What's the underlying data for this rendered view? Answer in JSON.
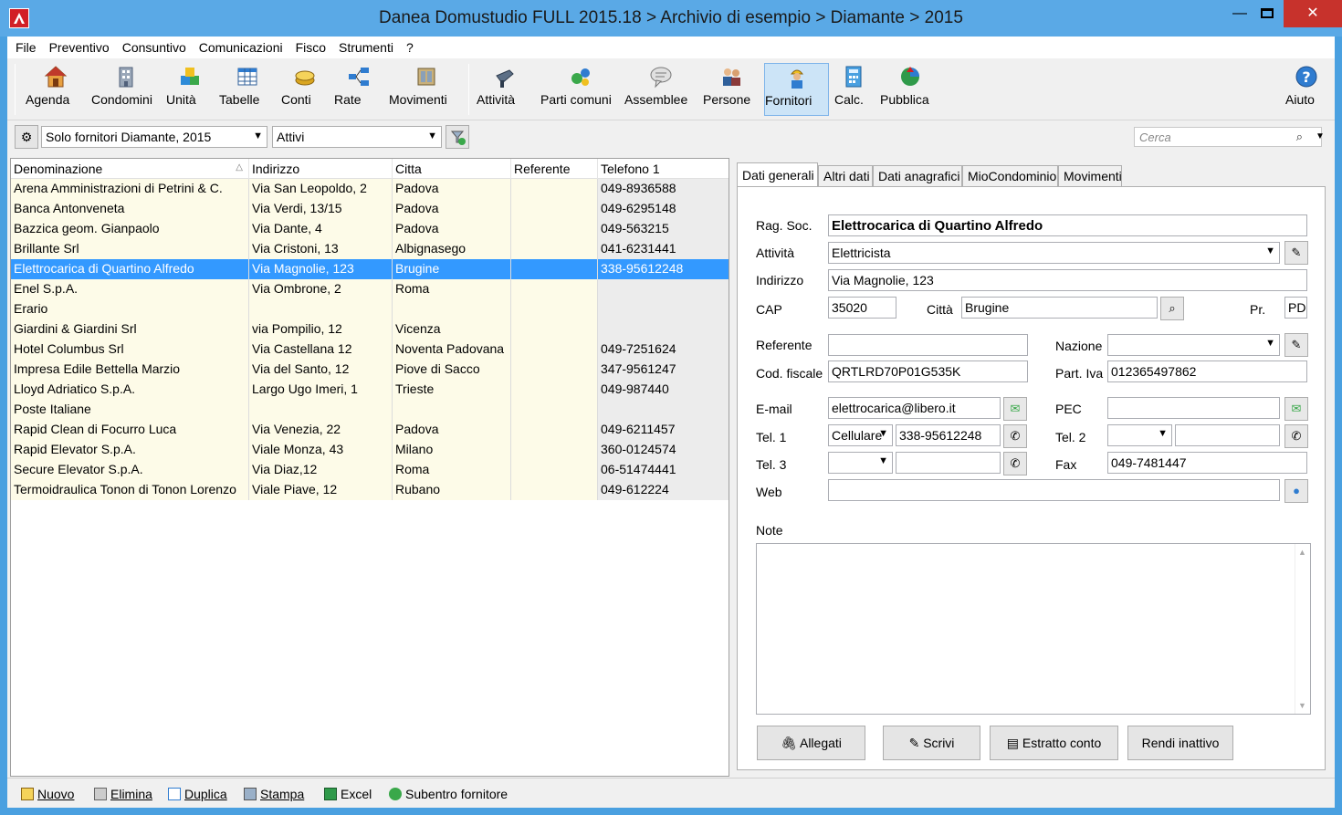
{
  "window": {
    "title": "Danea Domustudio FULL 2015.18 > Archivio di esempio > Diamante > 2015",
    "minimize": "—",
    "close": "✕"
  },
  "menu": [
    "File",
    "Preventivo",
    "Consuntivo",
    "Comunicazioni",
    "Fisco",
    "Strumenti",
    "?"
  ],
  "toolbar": {
    "buttons": [
      {
        "label": "Agenda",
        "icon": "house-icon"
      },
      {
        "label": "Condomini",
        "icon": "building-icon"
      },
      {
        "label": "Unità",
        "icon": "cubes-icon"
      },
      {
        "label": "Tabelle",
        "icon": "table-icon"
      },
      {
        "label": "Conti",
        "icon": "coins-icon"
      },
      {
        "label": "Rate",
        "icon": "flow-icon"
      },
      {
        "label": "Movimenti",
        "icon": "cash-icon"
      },
      {
        "label": "Attività",
        "icon": "drill-icon"
      },
      {
        "label": "Parti comuni",
        "icon": "gears-icon"
      },
      {
        "label": "Assemblee",
        "icon": "chat-icon"
      },
      {
        "label": "Persone",
        "icon": "people-icon"
      },
      {
        "label": "Fornitori",
        "icon": "worker-icon"
      },
      {
        "label": "Calc.",
        "icon": "calculator-icon"
      },
      {
        "label": "Pubblica",
        "icon": "globe-icon"
      }
    ],
    "help_label": "Aiuto",
    "active": "Fornitori"
  },
  "filters": {
    "supplier_filter": "Solo fornitori Diamante, 2015",
    "status_filter": "Attivi",
    "search_placeholder": "Cerca"
  },
  "grid": {
    "columns": [
      "Denominazione",
      "Indirizzo",
      "Citta",
      "Referente",
      "Telefono 1"
    ],
    "rows": [
      {
        "name": "Arena Amministrazioni di Petrini & C.",
        "address": "Via San Leopoldo, 2",
        "city": "Padova",
        "ref": "",
        "tel": "049-8936588"
      },
      {
        "name": "Banca Antonveneta",
        "address": "Via Verdi, 13/15",
        "city": "Padova",
        "ref": "",
        "tel": "049-6295148"
      },
      {
        "name": "Bazzica geom. Gianpaolo",
        "address": "Via Dante, 4",
        "city": "Padova",
        "ref": "",
        "tel": "049-563215"
      },
      {
        "name": "Brillante Srl",
        "address": "Via Cristoni, 13",
        "city": "Albignasego",
        "ref": "",
        "tel": "041-6231441"
      },
      {
        "name": "Elettrocarica di Quartino Alfredo",
        "address": "Via Magnolie, 123",
        "city": "Brugine",
        "ref": "",
        "tel": "338-95612248"
      },
      {
        "name": "Enel S.p.A.",
        "address": "Via Ombrone, 2",
        "city": "Roma",
        "ref": "",
        "tel": ""
      },
      {
        "name": "Erario",
        "address": "",
        "city": "",
        "ref": "",
        "tel": ""
      },
      {
        "name": "Giardini & Giardini Srl",
        "address": "via Pompilio, 12",
        "city": "Vicenza",
        "ref": "",
        "tel": ""
      },
      {
        "name": "Hotel Columbus Srl",
        "address": "Via Castellana 12",
        "city": "Noventa Padovana",
        "ref": "",
        "tel": "049-7251624"
      },
      {
        "name": "Impresa Edile Bettella Marzio",
        "address": "Via del Santo, 12",
        "city": "Piove di Sacco",
        "ref": "",
        "tel": "347-9561247"
      },
      {
        "name": "Lloyd Adriatico S.p.A.",
        "address": "Largo Ugo Imeri, 1",
        "city": "Trieste",
        "ref": "",
        "tel": "049-987440"
      },
      {
        "name": "Poste Italiane",
        "address": "",
        "city": "",
        "ref": "",
        "tel": ""
      },
      {
        "name": "Rapid Clean di Focurro Luca",
        "address": "Via Venezia, 22",
        "city": "Padova",
        "ref": "",
        "tel": "049-6211457"
      },
      {
        "name": "Rapid Elevator S.p.A.",
        "address": "Viale Monza, 43",
        "city": "Milano",
        "ref": "",
        "tel": "360-0124574"
      },
      {
        "name": "Secure Elevator S.p.A.",
        "address": "Via Diaz,12",
        "city": "Roma",
        "ref": "",
        "tel": "06-51474441"
      },
      {
        "name": "Termoidraulica Tonon di Tonon Lorenzo",
        "address": "Viale Piave, 12",
        "city": "Rubano",
        "ref": "",
        "tel": "049-612224"
      }
    ],
    "selected_index": 4
  },
  "tabs": [
    "Dati generali",
    "Altri dati",
    "Dati anagrafici",
    "MioCondominio",
    "Movimenti"
  ],
  "detail": {
    "labels": {
      "rag_soc": "Rag. Soc.",
      "attivita": "Attività",
      "indirizzo": "Indirizzo",
      "cap": "CAP",
      "citta": "Città",
      "pr": "Pr.",
      "referente": "Referente",
      "nazione": "Nazione",
      "cod_fiscale": "Cod. fiscale",
      "part_iva": "Part. Iva",
      "email": "E-mail",
      "pec": "PEC",
      "tel1": "Tel. 1",
      "tel2": "Tel. 2",
      "tel3": "Tel. 3",
      "fax": "Fax",
      "web": "Web",
      "note": "Note"
    },
    "values": {
      "rag_soc": "Elettrocarica di Quartino Alfredo",
      "attivita": "Elettricista",
      "indirizzo": "Via Magnolie, 123",
      "cap": "35020",
      "citta": "Brugine",
      "pr": "PD",
      "referente": "",
      "nazione": "",
      "cod_fiscale": "QRTLRD70P01G535K",
      "part_iva": "012365497862",
      "email": "elettrocarica@libero.it",
      "pec": "",
      "tel1_type": "Cellulare",
      "tel1": "338-95612248",
      "tel2_type": "",
      "tel2": "",
      "tel3_type": "",
      "tel3": "",
      "fax": "049-7481447",
      "web": "",
      "note": ""
    },
    "actions": [
      "Allegati",
      "Scrivi",
      "Estratto conto",
      "Rendi inattivo"
    ]
  },
  "bottom": [
    "Nuovo",
    "Elimina",
    "Duplica",
    "Stampa",
    "Excel",
    "Subentro fornitore"
  ]
}
